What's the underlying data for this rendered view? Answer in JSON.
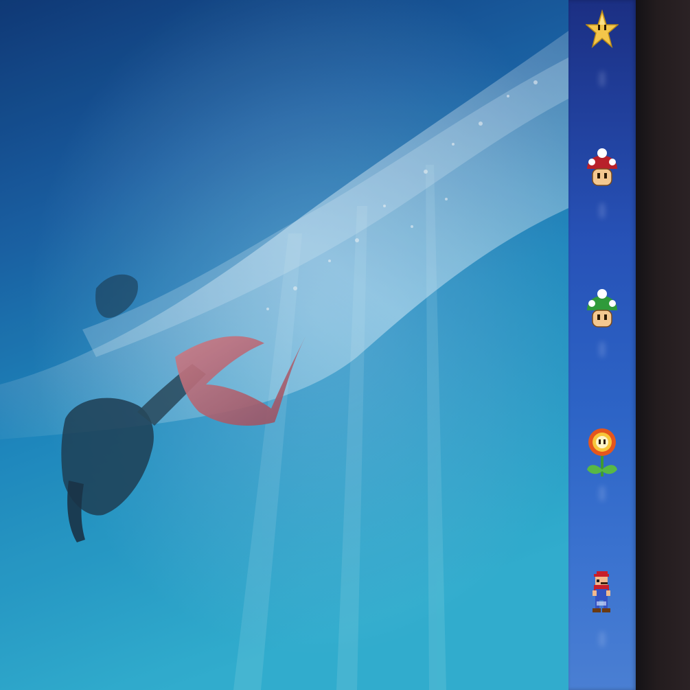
{
  "desktop": {
    "wallpaper": {
      "name": "underwater-mermaid-swimmer-wallpaper"
    },
    "colors": {
      "water_top": "#0f3a78",
      "water_mid": "#1a74b5",
      "water_bottom": "#33b4d4",
      "dock": "#2752b7"
    }
  },
  "dock": {
    "items": [
      {
        "name": "star-icon",
        "label": ""
      },
      {
        "name": "red-mushroom-icon",
        "label": ""
      },
      {
        "name": "green-mushroom-icon",
        "label": ""
      },
      {
        "name": "fire-flower-icon",
        "label": ""
      },
      {
        "name": "mario-icon",
        "label": ""
      }
    ]
  }
}
